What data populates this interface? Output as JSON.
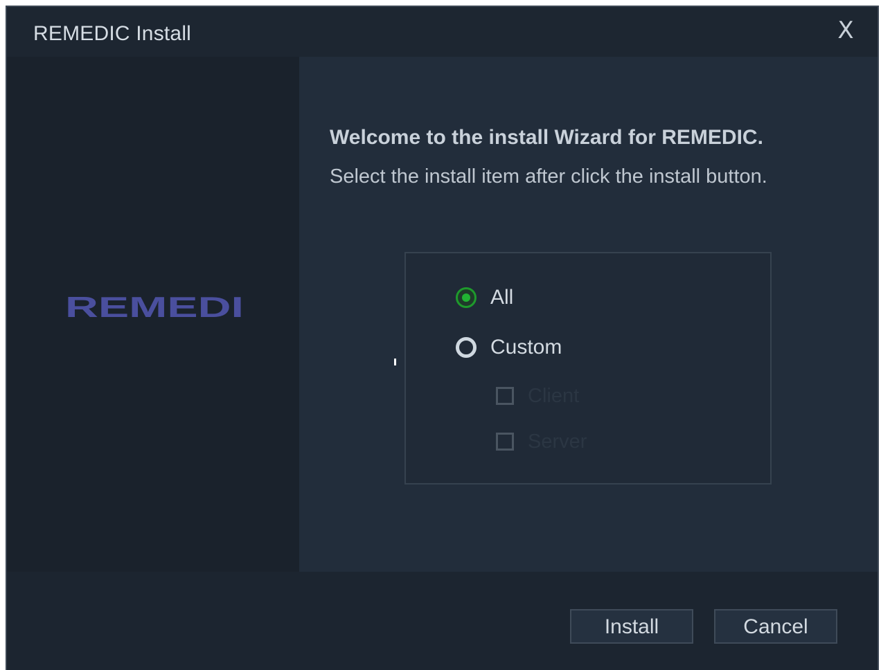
{
  "window": {
    "title": "REMEDIC Install",
    "close_label": "X"
  },
  "brand": {
    "logo_text": "REMEDI",
    "logo_color": "#4a4f9e"
  },
  "intro": {
    "welcome": "Welcome to the install Wizard for REMEDIC.",
    "instructions": "Select the install item after click the install button."
  },
  "options": {
    "all_label": "All",
    "custom_label": "Custom",
    "selected": "All",
    "sub_items": [
      {
        "label": "Client",
        "checked": false,
        "enabled": false
      },
      {
        "label": "Server",
        "checked": false,
        "enabled": false
      }
    ]
  },
  "footer": {
    "install_label": "Install",
    "cancel_label": "Cancel"
  },
  "colors": {
    "accent_green": "#21b333",
    "panel_dark": "#1a222c",
    "panel_main": "#222d3b"
  }
}
